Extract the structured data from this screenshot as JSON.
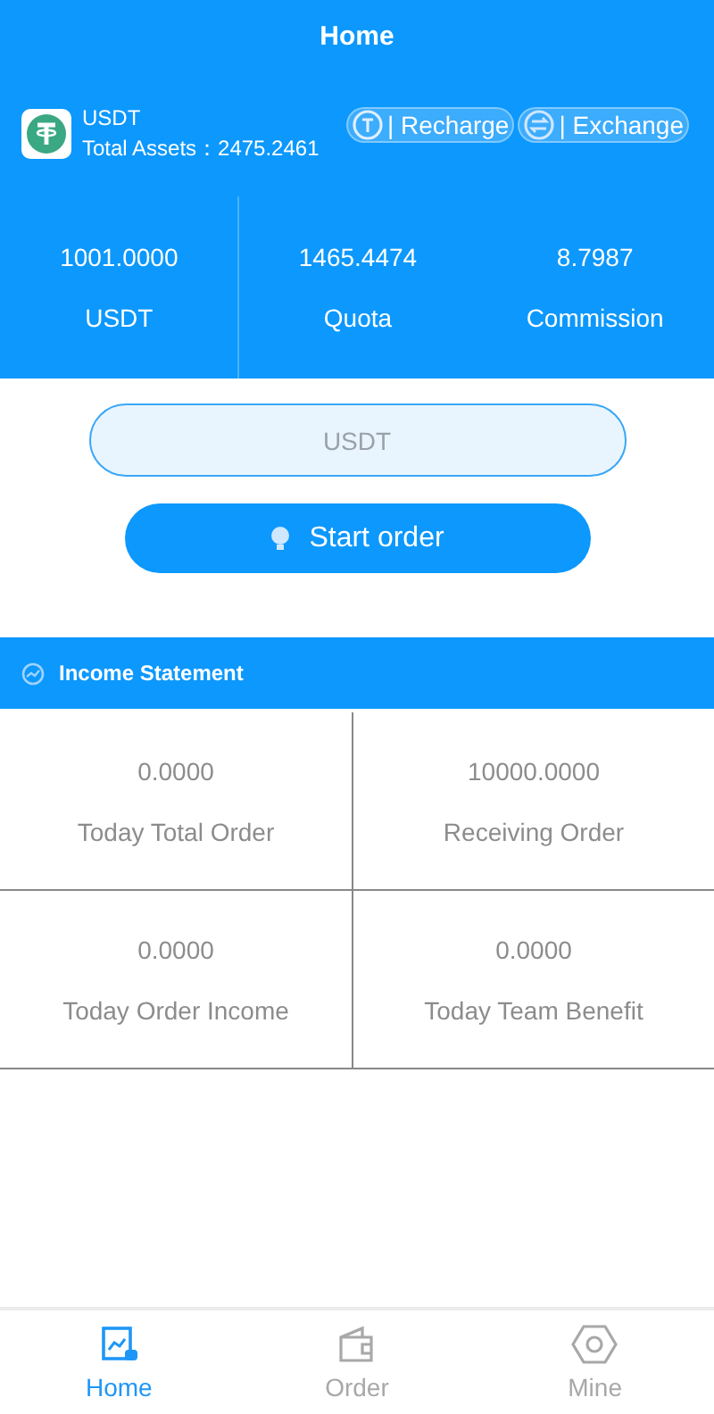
{
  "header": {
    "title": "Home"
  },
  "account": {
    "currency": "USDT",
    "total_assets": "Total Assets：2475.2461",
    "actions": [
      {
        "label": "| Recharge",
        "kind": "recharge"
      },
      {
        "label": "| Exchange",
        "kind": "exchange"
      }
    ]
  },
  "balances": [
    {
      "value": "1001.0000",
      "label": "USDT"
    },
    {
      "value": "1465.4474",
      "label": "Quota"
    },
    {
      "value": "8.7987",
      "label": "Commission"
    }
  ],
  "order_form": {
    "currency_field": {
      "placeholder": "USDT"
    },
    "start_button": "Start order"
  },
  "income_statement": {
    "title": "Income Statement",
    "cells": [
      {
        "value": "0.0000",
        "label": "Today Total Order"
      },
      {
        "value": "10000.0000",
        "label": "Receiving Order"
      },
      {
        "value": "0.0000",
        "label": "Today Order Income"
      },
      {
        "value": "0.0000",
        "label": "Today Team Benefit"
      }
    ]
  },
  "tab_bar": [
    {
      "label": "Home",
      "kind": "home",
      "selected": true
    },
    {
      "label": "Order",
      "kind": "order",
      "selected": false
    },
    {
      "label": "Mine",
      "kind": "mine",
      "selected": false
    }
  ]
}
